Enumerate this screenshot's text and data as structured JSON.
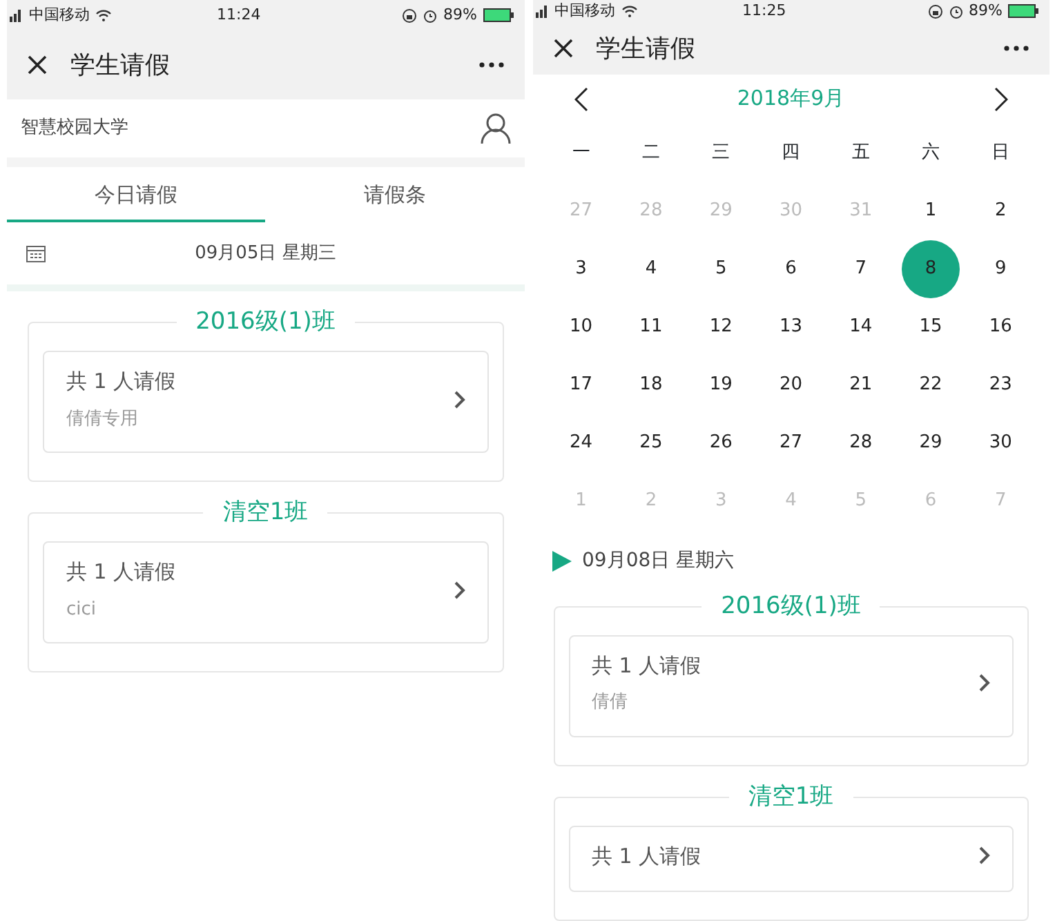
{
  "screens": [
    {
      "status_bar": {
        "carrier": "中国移动",
        "time": "11:24",
        "battery": "89%"
      },
      "title_bar": {
        "title": "学生请假"
      },
      "school": "智慧校园大学",
      "tabs": [
        {
          "label": "今日请假",
          "selected": true
        },
        {
          "label": "请假条",
          "selected": false
        }
      ],
      "date": "09月05日 星期三",
      "groups": [
        {
          "title": "2016级(1)班",
          "cards": [
            {
              "count": "共 1 人请假",
              "names": "倩倩专用"
            }
          ]
        },
        {
          "title": "清空1班",
          "cards": [
            {
              "count": "共 1 人请假",
              "names": "cici"
            }
          ]
        }
      ]
    },
    {
      "status_bar": {
        "carrier": "中国移动",
        "time": "11:25",
        "battery": "89%"
      },
      "title_bar": {
        "title": "学生请假"
      },
      "calendar": {
        "month": "2018年9月",
        "weekdays": [
          "一",
          "二",
          "三",
          "四",
          "五",
          "六",
          "日"
        ],
        "days": [
          {
            "label": "27",
            "muted": true,
            "selected": false
          },
          {
            "label": "28",
            "muted": true,
            "selected": false
          },
          {
            "label": "29",
            "muted": true,
            "selected": false
          },
          {
            "label": "30",
            "muted": true,
            "selected": false
          },
          {
            "label": "31",
            "muted": true,
            "selected": false
          },
          {
            "label": "1",
            "muted": false,
            "selected": false
          },
          {
            "label": "2",
            "muted": false,
            "selected": false
          },
          {
            "label": "3",
            "muted": false,
            "selected": false
          },
          {
            "label": "4",
            "muted": false,
            "selected": false
          },
          {
            "label": "5",
            "muted": false,
            "selected": false
          },
          {
            "label": "6",
            "muted": false,
            "selected": false
          },
          {
            "label": "7",
            "muted": false,
            "selected": false
          },
          {
            "label": "8",
            "muted": false,
            "selected": true
          },
          {
            "label": "9",
            "muted": false,
            "selected": false
          },
          {
            "label": "10",
            "muted": false,
            "selected": false
          },
          {
            "label": "11",
            "muted": false,
            "selected": false
          },
          {
            "label": "12",
            "muted": false,
            "selected": false
          },
          {
            "label": "13",
            "muted": false,
            "selected": false
          },
          {
            "label": "14",
            "muted": false,
            "selected": false
          },
          {
            "label": "15",
            "muted": false,
            "selected": false
          },
          {
            "label": "16",
            "muted": false,
            "selected": false
          },
          {
            "label": "17",
            "muted": false,
            "selected": false
          },
          {
            "label": "18",
            "muted": false,
            "selected": false
          },
          {
            "label": "19",
            "muted": false,
            "selected": false
          },
          {
            "label": "20",
            "muted": false,
            "selected": false
          },
          {
            "label": "21",
            "muted": false,
            "selected": false
          },
          {
            "label": "22",
            "muted": false,
            "selected": false
          },
          {
            "label": "23",
            "muted": false,
            "selected": false
          },
          {
            "label": "24",
            "muted": false,
            "selected": false
          },
          {
            "label": "25",
            "muted": false,
            "selected": false
          },
          {
            "label": "26",
            "muted": false,
            "selected": false
          },
          {
            "label": "27",
            "muted": false,
            "selected": false
          },
          {
            "label": "28",
            "muted": false,
            "selected": false
          },
          {
            "label": "29",
            "muted": false,
            "selected": false
          },
          {
            "label": "30",
            "muted": false,
            "selected": false
          },
          {
            "label": "1",
            "muted": true,
            "selected": false
          },
          {
            "label": "2",
            "muted": true,
            "selected": false
          },
          {
            "label": "3",
            "muted": true,
            "selected": false
          },
          {
            "label": "4",
            "muted": true,
            "selected": false
          },
          {
            "label": "5",
            "muted": true,
            "selected": false
          },
          {
            "label": "6",
            "muted": true,
            "selected": false
          },
          {
            "label": "7",
            "muted": true,
            "selected": false
          }
        ]
      },
      "selected_date": "09月08日 星期六",
      "groups": [
        {
          "title": "2016级(1)班",
          "cards": [
            {
              "count": "共 1 人请假",
              "names": "倩倩"
            }
          ]
        },
        {
          "title": "清空1班",
          "cards": [
            {
              "count": "共 1 人请假"
            }
          ]
        }
      ]
    }
  ]
}
